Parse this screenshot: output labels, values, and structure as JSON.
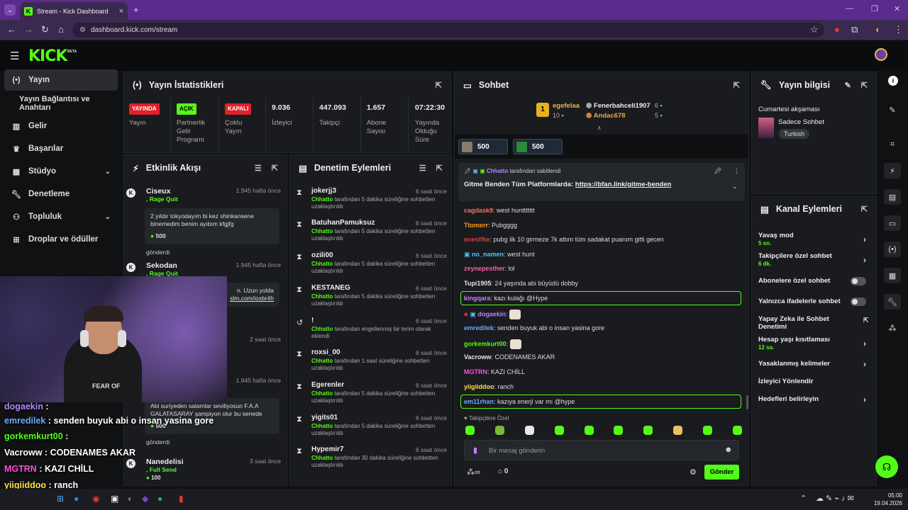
{
  "browser": {
    "tab_title": "Stream - Kick Dashboard",
    "url": "dashboard.kick.com/stream"
  },
  "brand": {
    "logo": "KICK",
    "beta": "BETA",
    "accent": "#53fc18"
  },
  "sidebar": {
    "items": [
      {
        "label": "Yayın",
        "icon": "broadcast-icon"
      },
      {
        "label": "Yayın Bağlantısı ve Anahtarı",
        "icon": ""
      },
      {
        "label": "Gelir",
        "icon": "chart-icon"
      },
      {
        "label": "Başarılar",
        "icon": "trophy-icon"
      },
      {
        "label": "Stüdyo",
        "icon": "studio-icon"
      },
      {
        "label": "Denetleme",
        "icon": "wrench-icon"
      },
      {
        "label": "Topluluk",
        "icon": "community-icon"
      },
      {
        "label": "Droplar ve ödüller",
        "icon": "gift-icon"
      }
    ]
  },
  "stats": {
    "title": "Yayın İstatistikleri",
    "items": [
      {
        "badge": "YAYINDA",
        "label": "Yayın"
      },
      {
        "badge": "AÇIK",
        "label": "Partnerlik Gelir Programı"
      },
      {
        "badge": "KAPALI",
        "label": "Çoklu Yayın"
      },
      {
        "value": "9.036",
        "label": "İzleyici"
      },
      {
        "value": "447.093",
        "label": "Takipçi"
      },
      {
        "value": "1.657",
        "label": "Abone Sayısı"
      },
      {
        "value": "07:22:30",
        "label": "Yayında Olduğu Süre"
      }
    ]
  },
  "feed": {
    "title": "Etkinlik Akışı",
    "items": [
      {
        "name": "Ciseux",
        "sub": ", Rage Quit",
        "time": "1.945 hafta önce",
        "msg": "2 yıldır tokyodayım bi kez shinkansene binemedim benim ayıbım kfgjfg",
        "amount": "500",
        "footer": "gönderdi"
      },
      {
        "name": "Sekodan",
        "sub": ", Rage Quit",
        "time": "1.945 hafta önce",
        "msg": "n. Uzun yolda",
        "link": "slm.com/ioxbr4h"
      },
      {
        "time": "2 saat önce"
      },
      {
        "time": "1.945 hafta önce",
        "msg": "Abi suriyeden salamlar seviliyosun F.A.A GALATASARAY şampiyon olur bu senede",
        "amount": "500",
        "footer": "gönderdi"
      },
      {
        "name": "Nanedelisi",
        "sub": ", Full Send",
        "time": "3 saat önce",
        "amount": "100"
      }
    ]
  },
  "mod": {
    "title": "Denetim Eylemleri",
    "items": [
      {
        "name": "jokerjj3",
        "time": "6 saat önce",
        "actor": "Chhatto",
        "text": "tarafından 5 dakika süreliğine sohbetten uzaklaştırıldı"
      },
      {
        "name": "BatuhanPamuksuz",
        "time": "6 saat önce",
        "actor": "Chhatto",
        "text": "tarafından 5 dakika süreliğine sohbetten uzaklaştırıldı"
      },
      {
        "name": "ozili00",
        "time": "6 saat önce",
        "actor": "Chhatto",
        "text": "tarafından 5 dakika süreliğine sohbetten uzaklaştırıldı"
      },
      {
        "name": "KESTANEG",
        "time": "6 saat önce",
        "actor": "Chhatto",
        "text": "tarafından 5 dakika süreliğine sohbetten uzaklaştırıldı"
      },
      {
        "name": "!",
        "time": "6 saat önce",
        "actor": "Chhatto",
        "text": "tarafından engellenmiş bir terim olarak eklendi"
      },
      {
        "name": "roxsi_00",
        "time": "6 saat önce",
        "actor": "Chhatto",
        "text": "tarafından 1 saat süreliğine sohbetten uzaklaştırıldı"
      },
      {
        "name": "Egerenler",
        "time": "6 saat önce",
        "actor": "Chhatto",
        "text": "tarafından 5 dakika süreliğine sohbetten uzaklaştırıldı"
      },
      {
        "name": "yigits01",
        "time": "6 saat önce",
        "actor": "Chhatto",
        "text": "tarafından 5 dakika süreliğine sohbetten uzaklaştırıldı"
      },
      {
        "name": "Hypemir7",
        "time": "6 saat önce",
        "actor": "Chhatto",
        "text": "tarafından 30 dakika süreliğine sohbetten uzaklaştırıldı"
      }
    ]
  },
  "chat": {
    "title": "Sohbet",
    "top": [
      {
        "name": "egefelaa",
        "count": "10"
      },
      {
        "name": "Fenerbahceli1907",
        "count": "6"
      },
      {
        "name": "Andac678",
        "count": "5"
      }
    ],
    "gifts": [
      "500",
      "500"
    ],
    "pinned": {
      "by": "Chhatto",
      "by_text": "tarafından sabitlendi",
      "text": "Gitme Benden Tüm Platformlarda:",
      "link": "https://bfan.link/gitme-benden"
    },
    "messages": [
      {
        "user": "cagdask9",
        "color": "#ff6b6b",
        "text": "west hunttttttt"
      },
      {
        "user": "Ttomerr",
        "color": "#ff9f1a",
        "text": "Pubgggg"
      },
      {
        "user": "enestfke",
        "color": "#e03a3a",
        "text": "pubg ilk 10 girmeze 7k attım tüm sadakat puanım gitti gecen"
      },
      {
        "user": "no_namen",
        "color": "#4fc3f7",
        "text": "west hunt"
      },
      {
        "user": "zeynepesther",
        "color": "#ff5fa2",
        "text": "lol"
      },
      {
        "user": "Tupi1905",
        "color": "#e6e6e6",
        "text": "24 yaşında abi büyüdü dobby"
      },
      {
        "user": "kingqara",
        "color": "#c77dff",
        "text": "kazı kulağı @Hype"
      },
      {
        "user": "dogaekin",
        "color": "#b388ff",
        "text": ""
      },
      {
        "user": "emredilek",
        "color": "#6ea8ff",
        "text": "senden buyuk abi o insan yasina gore"
      },
      {
        "user": "gorkemkurt00",
        "color": "#53fc18",
        "text": ""
      },
      {
        "user": "Vacroww",
        "color": "#e6e6e6",
        "text": "CODENAMES AKAR"
      },
      {
        "user": "MGTRN",
        "color": "#ff4fd8",
        "text": "KAZI CHİLL"
      },
      {
        "user": "yiigiiddoo",
        "color": "#ffe14d",
        "text": "ranch"
      },
      {
        "user": "em11rhan",
        "color": "#6ea8ff",
        "text": "kazıya enerji var mı @hype"
      }
    ],
    "mode": "Takipçilere Özel",
    "input_placeholder": "Bir mesaj gönderin",
    "points": "0",
    "send": "Gönder"
  },
  "info": {
    "title": "Yayın bilgisi",
    "stream_title": "Cumartesi akşaması",
    "category": "Sadece Sohbet",
    "tag": "Turkish"
  },
  "actions": {
    "title": "Kanal Eylemleri",
    "items": [
      {
        "label": "Yavaş mod",
        "sub": "5 sn.",
        "type": "chev"
      },
      {
        "label": "Takipçilere özel sohbet",
        "sub": "6 dk.",
        "type": "chev"
      },
      {
        "label": "Abonelere özel sohbet",
        "type": "toggle"
      },
      {
        "label": "Yalnızca ifadelerle sohbet",
        "type": "toggle"
      },
      {
        "label": "Yapay Zeka ile Sohbet Denetimi",
        "type": "ext"
      },
      {
        "label": "Hesap yaşı kısıtlaması",
        "sub": "12 sa.",
        "type": "chev"
      },
      {
        "label": "Yasaklanmış kelimeler",
        "type": "chev"
      },
      {
        "label": "İzleyici Yönlendir",
        "type": "none"
      },
      {
        "label": "Hedefleri belirleyin",
        "type": "chev"
      }
    ]
  },
  "overlay": [
    {
      "user": "dogaekin",
      "color": "#b388ff",
      "text": ":"
    },
    {
      "user": "emredilek",
      "color": "#6ea8ff",
      "text": ": senden buyuk abi o insan yasina gore"
    },
    {
      "user": "gorkemkurt00",
      "color": "#53fc18",
      "text": ":"
    },
    {
      "user": "Vacroww",
      "color": "#ffffff",
      "text": ": CODENAMES AKAR"
    },
    {
      "user": "MGTRN",
      "color": "#ff4fd8",
      "text": ": KAZI CHİLL"
    },
    {
      "user": "yiigiiddoo",
      "color": "#ffe14d",
      "text": ": ranch"
    },
    {
      "user": "em11rhan",
      "color": "#6ea8ff",
      "text": ": kazıya enerji var mı @hype"
    }
  ],
  "webcam": {
    "shirt": "FEAR OF"
  },
  "taskbar": {
    "time": "05:00",
    "date": "19.04.2026"
  }
}
